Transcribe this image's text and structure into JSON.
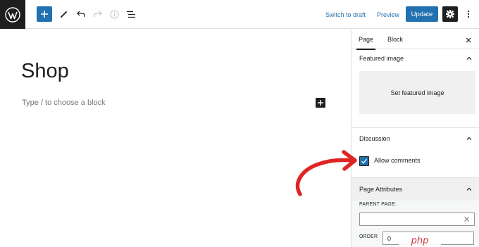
{
  "toolbar": {
    "switch_to_draft": "Switch to draft",
    "preview": "Preview",
    "update": "Update"
  },
  "editor": {
    "title": "Shop",
    "block_placeholder": "Type / to choose a block"
  },
  "sidebar": {
    "tabs": [
      {
        "label": "Page",
        "active": true
      },
      {
        "label": "Block",
        "active": false
      }
    ],
    "featured_image": {
      "title": "Featured image",
      "set_label": "Set featured image"
    },
    "discussion": {
      "title": "Discussion",
      "allow_comments_label": "Allow comments",
      "allow_comments_checked": true
    },
    "page_attributes": {
      "title": "Page Attributes",
      "parent_page_label": "PARENT PAGE:",
      "parent_page_value": "",
      "order_label": "ORDER",
      "order_value": "0"
    }
  },
  "watermark": "php",
  "colors": {
    "accent": "#2271b1",
    "dark": "#1e1e1e",
    "annotation": "#e02424"
  }
}
